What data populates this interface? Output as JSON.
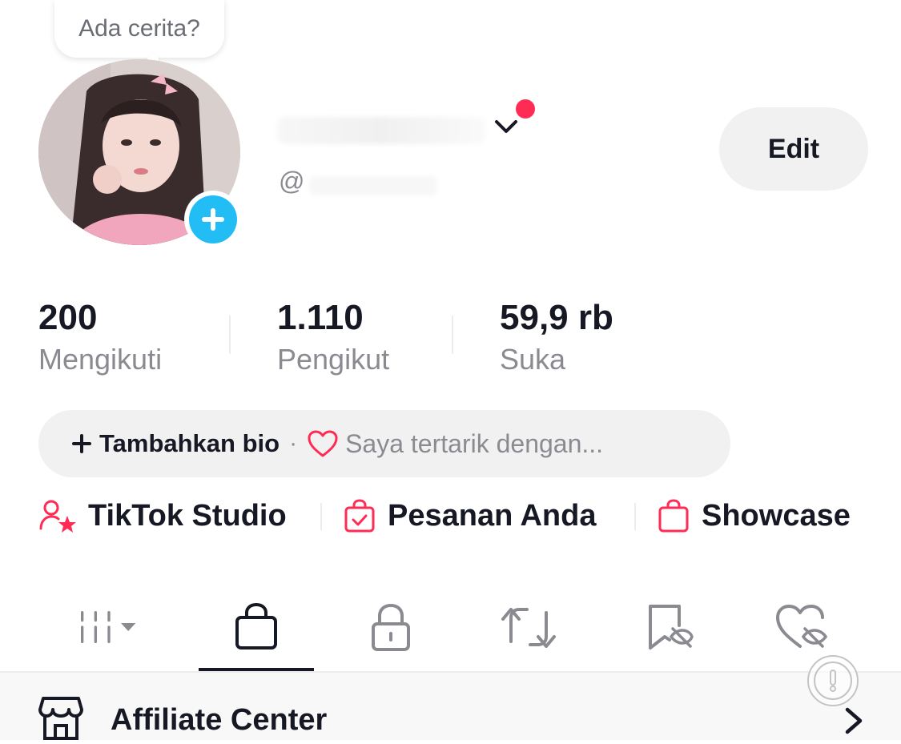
{
  "story": {
    "prompt": "Ada cerita?"
  },
  "profile": {
    "handle_prefix": "@",
    "edit_label": "Edit"
  },
  "stats": [
    {
      "value": "200",
      "label": "Mengikuti"
    },
    {
      "value": "1.110",
      "label": "Pengikut"
    },
    {
      "value": "59,9 rb",
      "label": "Suka"
    }
  ],
  "bio": {
    "add_label": "Tambahkan bio",
    "separator": "·",
    "interest_label": "Saya tertarik dengan..."
  },
  "quick_links": [
    {
      "label": "TikTok Studio",
      "icon": "person-star-icon"
    },
    {
      "label": "Pesanan Anda",
      "icon": "order-bag-icon"
    },
    {
      "label": "Showcase",
      "icon": "shopping-bag-icon"
    }
  ],
  "tabs": [
    {
      "icon": "videos-grid-icon",
      "active": false
    },
    {
      "icon": "shop-bag-icon",
      "active": true
    },
    {
      "icon": "lock-icon",
      "active": false
    },
    {
      "icon": "repost-icon",
      "active": false
    },
    {
      "icon": "favorites-hidden-icon",
      "active": false
    },
    {
      "icon": "liked-hidden-icon",
      "active": false
    }
  ],
  "affiliate": {
    "label": "Affiliate Center"
  },
  "colors": {
    "accent": "#fe2c55",
    "add_button": "#22bdf5",
    "muted_text": "#8a8b91",
    "pill_bg": "#f1f1f2"
  }
}
